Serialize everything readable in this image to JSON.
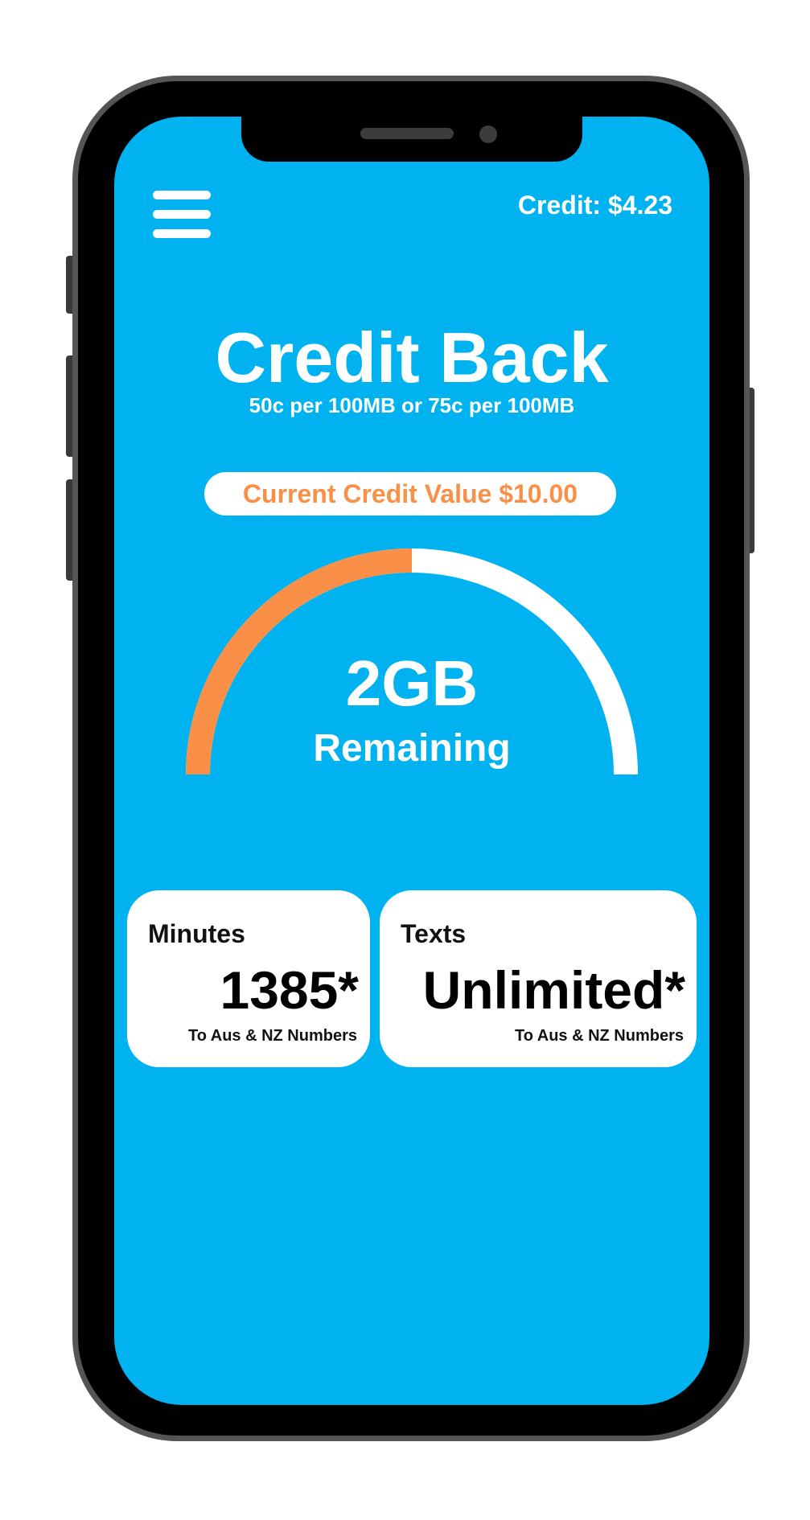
{
  "header": {
    "credit_balance": "Credit: $4.23",
    "menu_icon": "hamburger-menu-icon"
  },
  "hero": {
    "title": "Credit Back",
    "subtitle": "50c per 100MB or 75c per 100MB",
    "credit_value_label": "Current Credit Value $10.00"
  },
  "gauge": {
    "value": "2GB",
    "label": "Remaining",
    "used_fraction": 0.5,
    "used_color": "#fa9048",
    "track_color": "#ffffff"
  },
  "cards": {
    "minutes": {
      "title": "Minutes",
      "value": "1385*",
      "note": "To Aus & NZ Numbers"
    },
    "texts": {
      "title": "Texts",
      "value": "Unlimited*",
      "note": "To Aus & NZ Numbers"
    }
  },
  "colors": {
    "screen_background": "#00b2ef",
    "accent": "#fa9048",
    "text_light": "#ffffff",
    "text_dark": "#000000"
  }
}
